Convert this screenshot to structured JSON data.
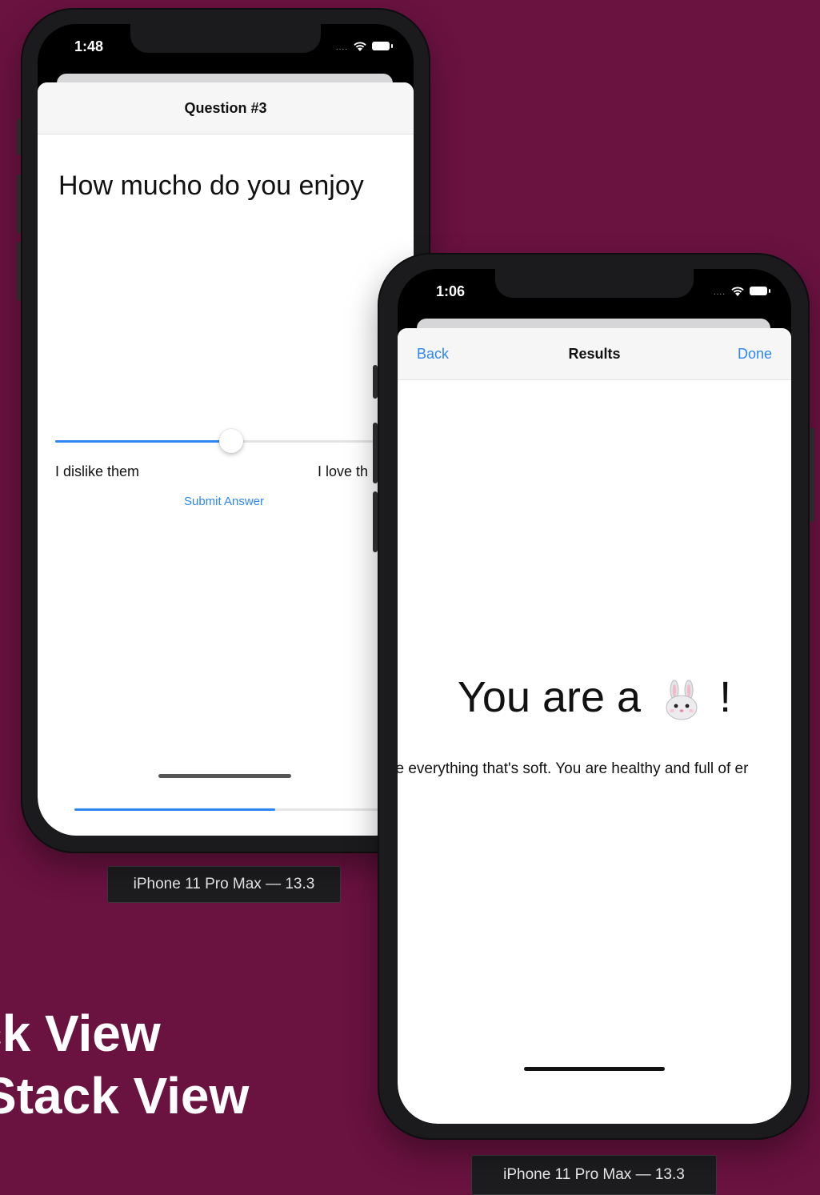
{
  "background": {
    "color": "#6a1240",
    "title_line1": "ck View",
    "title_line2": "Stack View"
  },
  "phone1": {
    "status_time": "1:48",
    "nav_title": "Question #3",
    "question": "How mucho do you enjoy",
    "slider": {
      "value": 0.5,
      "min_label": "I dislike them",
      "max_label": "I love th"
    },
    "submit_label": "Submit Answer",
    "progress": 0.66,
    "device_label": "iPhone 11 Pro Max — 13.3"
  },
  "phone2": {
    "status_time": "1:06",
    "nav_back": "Back",
    "nav_title": "Results",
    "nav_done": "Done",
    "result_title_prefix": "You are a",
    "result_title_suffix": "!",
    "result_icon": "bunny-face-icon",
    "result_description": "ve everything that's soft. You are healthy and full of er",
    "device_label": "iPhone 11 Pro Max — 13.3"
  },
  "colors": {
    "accent": "#2e86f5",
    "device_frame": "#1b1b1d"
  }
}
